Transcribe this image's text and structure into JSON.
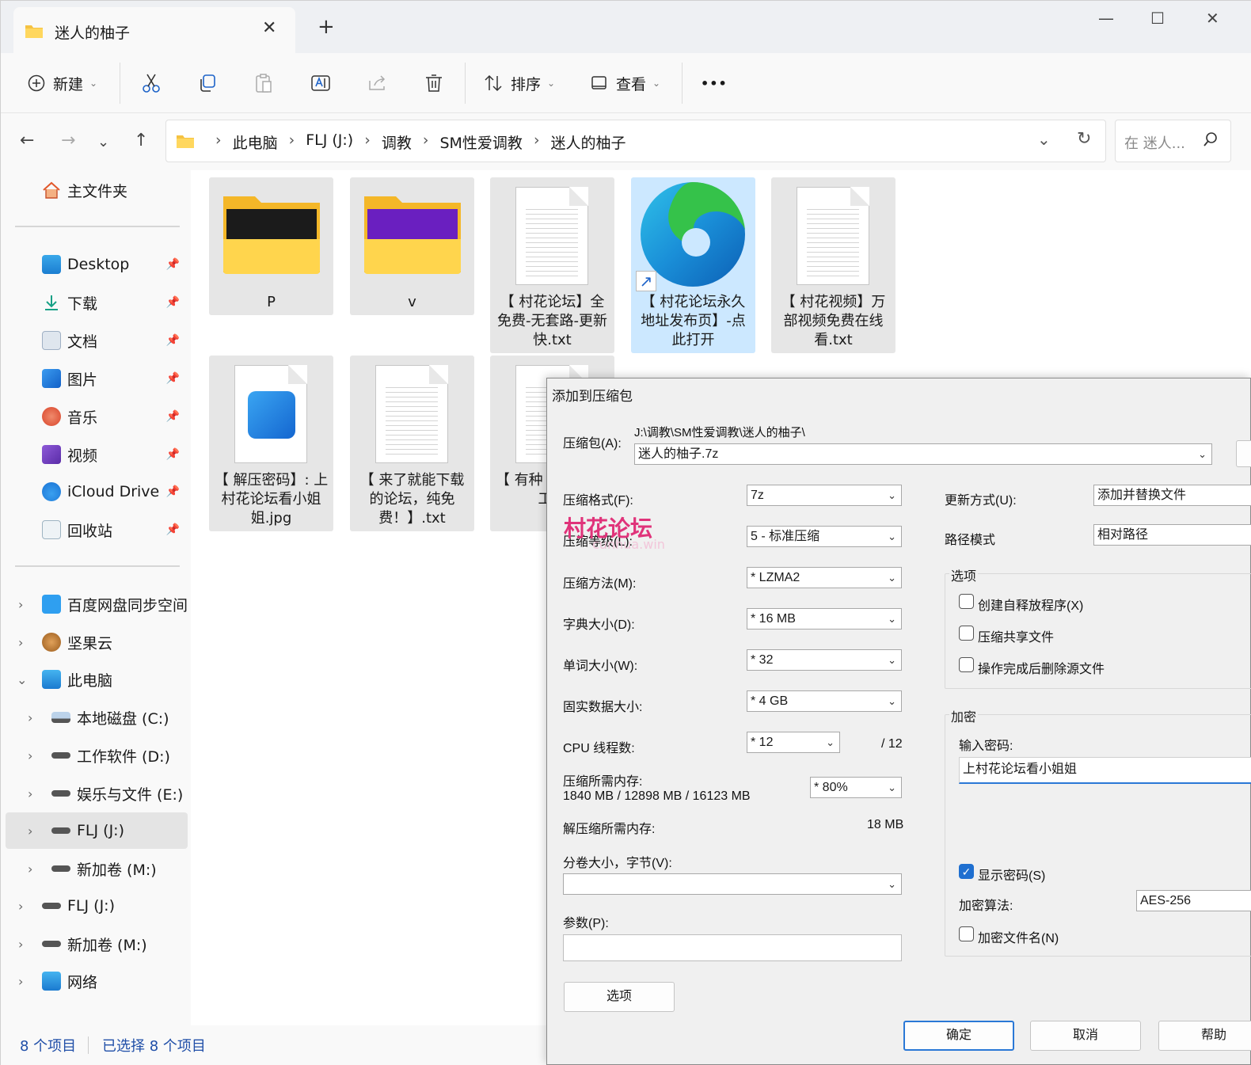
{
  "window": {
    "tab_title": "迷人的柚子"
  },
  "toolbar": {
    "new_label": "新建",
    "sort_label": "排序",
    "view_label": "查看",
    "more_label": "•••"
  },
  "address": {
    "crumbs": [
      "此电脑",
      "FLJ (J:)",
      "调教",
      "SM性爱调教",
      "迷人的柚子"
    ],
    "search_placeholder": "在 迷人..."
  },
  "sidebar": {
    "home": "主文件夹",
    "quick": [
      {
        "label": "Desktop"
      },
      {
        "label": "下载"
      },
      {
        "label": "文档"
      },
      {
        "label": "图片"
      },
      {
        "label": "音乐"
      },
      {
        "label": "视频"
      },
      {
        "label": "iCloud Drive"
      },
      {
        "label": "回收站"
      }
    ],
    "tree": [
      {
        "label": "百度网盘同步空间"
      },
      {
        "label": "坚果云"
      },
      {
        "label": "此电脑"
      },
      {
        "label": "本地磁盘 (C:)"
      },
      {
        "label": "工作软件 (D:)"
      },
      {
        "label": "娱乐与文件 (E:)"
      },
      {
        "label": "FLJ (J:)"
      },
      {
        "label": "新加卷 (M:)"
      },
      {
        "label": "FLJ (J:)"
      },
      {
        "label": "新加卷 (M:)"
      },
      {
        "label": "网络"
      }
    ]
  },
  "files": [
    {
      "name": "P"
    },
    {
      "name": "v"
    },
    {
      "name": "【 村花论坛】全免费-无套路-更新快.txt"
    },
    {
      "name": "【 村花论坛永久地址发布页】-点此打开"
    },
    {
      "name": "【 村花视频】万部视频免费在线看.txt"
    },
    {
      "name": "【 解压密码】: 上村花论坛看小姐姐.jpg"
    },
    {
      "name": "【 来了就能下载的论坛，纯免费！】.txt"
    },
    {
      "name": "【 有种 度？来 人工加"
    }
  ],
  "status": {
    "count": "8 个项目",
    "selected": "已选择 8 个项目"
  },
  "watermark": {
    "text": "村花论坛",
    "sub": "cunhua.win"
  },
  "dialog": {
    "title": "添加到压缩包",
    "archive_label": "压缩包(A):",
    "archive_path": "J:\\调教\\SM性爱调教\\迷人的柚子\\",
    "archive_name": "迷人的柚子.7z",
    "format_label": "压缩格式(F):",
    "format_value": "7z",
    "level_label": "压缩等级(L):",
    "level_value": "5 - 标准压缩",
    "method_label": "压缩方法(M):",
    "method_value": "*  LZMA2",
    "dict_label": "字典大小(D):",
    "dict_value": "*  16 MB",
    "word_label": "单词大小(W):",
    "word_value": "*  32",
    "solid_label": "固实数据大小:",
    "solid_value": "*  4 GB",
    "cpu_label": "CPU 线程数:",
    "cpu_value": "*  12",
    "cpu_total": "/ 12",
    "mem_label": "压缩所需内存:",
    "mem_value": "1840 MB / 12898 MB / 16123 MB",
    "mem_pct": "*  80%",
    "decomp_label": "解压缩所需内存:",
    "decomp_value": "18 MB",
    "split_label": "分卷大小，字节(V):",
    "params_label": "参数(P):",
    "options_btn": "选项",
    "update_label": "更新方式(U):",
    "update_value": "添加并替换文件",
    "path_label": "路径模式",
    "path_value": "相对路径",
    "options_group": "选项",
    "opt_sfx": "创建自释放程序(X)",
    "opt_shared": "压缩共享文件",
    "opt_delete": "操作完成后删除源文件",
    "enc_group": "加密",
    "pwd_label": "输入密码:",
    "pwd_value": "上村花论坛看小姐姐",
    "show_pwd": "显示密码(S)",
    "enc_method_label": "加密算法:",
    "enc_method_value": "AES-256",
    "enc_names": "加密文件名(N)",
    "ok": "确定",
    "cancel": "取消",
    "help": "帮助"
  }
}
